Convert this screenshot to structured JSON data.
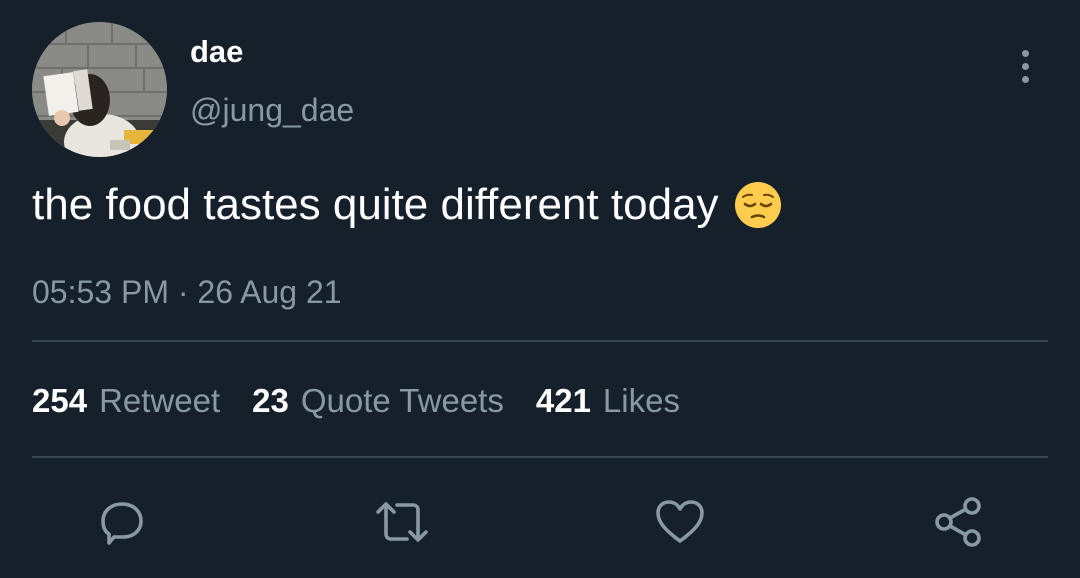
{
  "user": {
    "display_name": "dae",
    "handle": "@jung_dae"
  },
  "tweet": {
    "text": "the food tastes quite different today",
    "emoji": "pensive-face",
    "time": "05:53 PM",
    "separator": "·",
    "date": "26 Aug 21"
  },
  "stats": {
    "retweets": {
      "count": "254",
      "label": "Retweet"
    },
    "quotes": {
      "count": "23",
      "label": "Quote Tweets"
    },
    "likes": {
      "count": "421",
      "label": "Likes"
    }
  },
  "actions": [
    {
      "name": "reply",
      "icon": "speech-bubble-icon"
    },
    {
      "name": "retweet",
      "icon": "retweet-arrows-icon"
    },
    {
      "name": "like",
      "icon": "heart-icon"
    },
    {
      "name": "share",
      "icon": "share-nodes-icon"
    }
  ],
  "colors": {
    "background": "#15202b",
    "primary_text": "#ffffff",
    "secondary_text": "#8899a6",
    "divider": "#38444d",
    "emoji_yellow": "#ffcc4d"
  }
}
